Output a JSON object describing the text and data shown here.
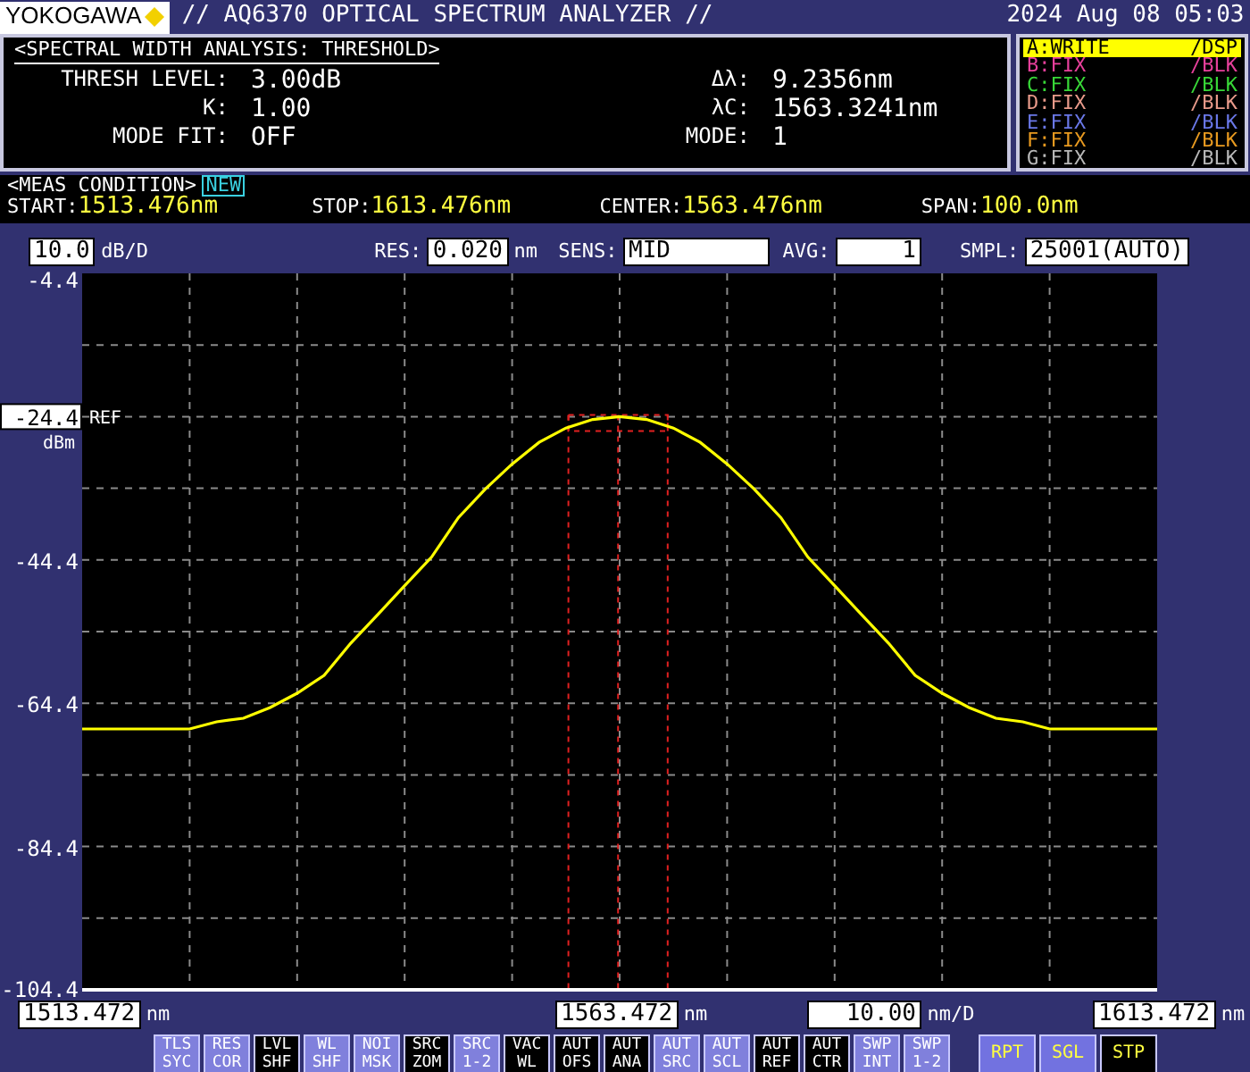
{
  "header": {
    "brand": "YOKOGAWA",
    "title": "// AQ6370 OPTICAL SPECTRUM ANALYZER //",
    "datetime": "2024 Aug 08 05:03"
  },
  "analysis": {
    "title": "<SPECTRAL WIDTH ANALYSIS: THRESHOLD>",
    "fields": [
      {
        "label": "THRESH LEVEL:",
        "value": "3.00dB"
      },
      {
        "label": "Δλ:",
        "value": "9.2356nm"
      },
      {
        "label": "K:",
        "value": "1.00"
      },
      {
        "label": "λC:",
        "value": "1563.3241nm"
      },
      {
        "label": "MODE FIT:",
        "value": "OFF"
      },
      {
        "label": "MODE:",
        "value": "1"
      }
    ]
  },
  "traces": [
    {
      "name": "A:WRITE",
      "mode": "/DSP",
      "color": "#ffff00",
      "selected": true
    },
    {
      "name": "B:FIX",
      "mode": "/BLK",
      "color": "#e8409c",
      "selected": false
    },
    {
      "name": "C:FIX",
      "mode": "/BLK",
      "color": "#38d838",
      "selected": false
    },
    {
      "name": "D:FIX",
      "mode": "/BLK",
      "color": "#e89a8a",
      "selected": false
    },
    {
      "name": "E:FIX",
      "mode": "/BLK",
      "color": "#6a78e8",
      "selected": false
    },
    {
      "name": "F:FIX",
      "mode": "/BLK",
      "color": "#e89a20",
      "selected": false
    },
    {
      "name": "G:FIX",
      "mode": "/BLK",
      "color": "#b8b8b8",
      "selected": false
    }
  ],
  "meas_condition": {
    "title": "<MEAS CONDITION>",
    "badge": "NEW",
    "fields": [
      {
        "label": "START:",
        "value": "1513.476nm"
      },
      {
        "label": "STOP:",
        "value": "1613.476nm"
      },
      {
        "label": "CENTER:",
        "value": "1563.476nm"
      },
      {
        "label": "SPAN:",
        "value": "100.0nm"
      }
    ]
  },
  "settings": {
    "scale": {
      "value": "10.0",
      "unit": "dB/D"
    },
    "fields": [
      {
        "label": "RES:",
        "value": "0.020",
        "unit": "nm"
      },
      {
        "label": "SENS:",
        "value": "MID"
      },
      {
        "label": "AVG:",
        "value": "1"
      },
      {
        "label": "SMPL:",
        "value": "25001(AUTO)"
      }
    ]
  },
  "spectrum": {
    "ref_label": "REF",
    "ref_unit": "dBm",
    "x_scale": {
      "value": "10.00",
      "unit": "nm/D"
    },
    "x_tick_units": [
      "nm",
      "nm",
      "nm"
    ],
    "chart_data": {
      "type": "line",
      "grid": true,
      "xlim": [
        1513.472,
        1613.472
      ],
      "ylim": [
        -104.4,
        -4.4
      ],
      "ref_lines": [
        {
          "axis": "x",
          "value": 1558.706
        },
        {
          "axis": "x",
          "value": 1563.3241
        },
        {
          "axis": "x",
          "value": 1567.942
        }
      ],
      "xticks": [
        {
          "value": 1513.472,
          "label": "1513.472"
        },
        {
          "value": 1563.472,
          "label": "1563.472"
        },
        {
          "value": 1613.472,
          "label": "1613.472"
        }
      ],
      "yticks": [
        {
          "value": -4.4,
          "label": "-4.4"
        },
        {
          "value": -24.4,
          "label": "-24.4"
        },
        {
          "value": -44.4,
          "label": "-44.4"
        },
        {
          "value": -64.4,
          "label": "-64.4"
        },
        {
          "value": -84.4,
          "label": "-84.4"
        },
        {
          "value": -104.4,
          "label": "-104.4"
        }
      ],
      "x": [
        1513.472,
        1515.972,
        1518.472,
        1520.972,
        1523.472,
        1525.972,
        1528.472,
        1530.972,
        1533.472,
        1535.972,
        1538.472,
        1540.972,
        1543.472,
        1545.972,
        1548.472,
        1550.972,
        1553.472,
        1555.972,
        1558.472,
        1560.972,
        1563.472,
        1565.972,
        1568.472,
        1570.972,
        1573.472,
        1575.972,
        1578.472,
        1580.972,
        1583.472,
        1585.972,
        1588.472,
        1590.972,
        1593.472,
        1595.972,
        1598.472,
        1600.972,
        1603.472,
        1605.972,
        1608.472,
        1610.972,
        1613.472
      ],
      "series": [
        {
          "color": "#ffff00",
          "values": [
            -68,
            -68,
            -68,
            -68,
            -68,
            -67,
            -66.5,
            -65,
            -63,
            -60.5,
            -56,
            -52,
            -48,
            -44,
            -38.5,
            -34.5,
            -31,
            -28,
            -26,
            -24.8,
            -24.4,
            -24.8,
            -26,
            -28,
            -31,
            -34.5,
            -38.5,
            -44,
            -48,
            -52,
            -56,
            -60.5,
            -63,
            -65,
            -66.5,
            -67,
            -68,
            -68,
            -68,
            -68,
            -68
          ]
        }
      ]
    }
  },
  "soft_keys": [
    {
      "label": "TLS\nSYC",
      "kind": "function",
      "on": false
    },
    {
      "label": "RES\nCOR",
      "kind": "function",
      "on": false
    },
    {
      "label": "LVL\nSHF",
      "kind": "function",
      "on": true
    },
    {
      "label": "WL\nSHF",
      "kind": "function",
      "on": false
    },
    {
      "label": "NOI\nMSK",
      "kind": "function",
      "on": false
    },
    {
      "label": "SRC\nZOM",
      "kind": "function",
      "on": true
    },
    {
      "label": "SRC\n1-2",
      "kind": "function",
      "on": false
    },
    {
      "label": "VAC\nWL",
      "kind": "function",
      "on": true
    },
    {
      "label": "AUT\nOFS",
      "kind": "function",
      "on": true
    },
    {
      "label": "AUT\nANA",
      "kind": "function",
      "on": true
    },
    {
      "label": "AUT\nSRC",
      "kind": "function",
      "on": false
    },
    {
      "label": "AUT\nSCL",
      "kind": "function",
      "on": false
    },
    {
      "label": "AUT\nREF",
      "kind": "function",
      "on": true
    },
    {
      "label": "AUT\nCTR",
      "kind": "function",
      "on": true
    },
    {
      "label": "SWP\nINT",
      "kind": "function",
      "on": false
    },
    {
      "label": "SWP\n1-2",
      "kind": "function",
      "on": false
    },
    {
      "label": "RPT",
      "kind": "sweep",
      "on": false
    },
    {
      "label": "SGL",
      "kind": "sweep",
      "on": false
    },
    {
      "label": "STP",
      "kind": "sweep",
      "on": true
    }
  ]
}
